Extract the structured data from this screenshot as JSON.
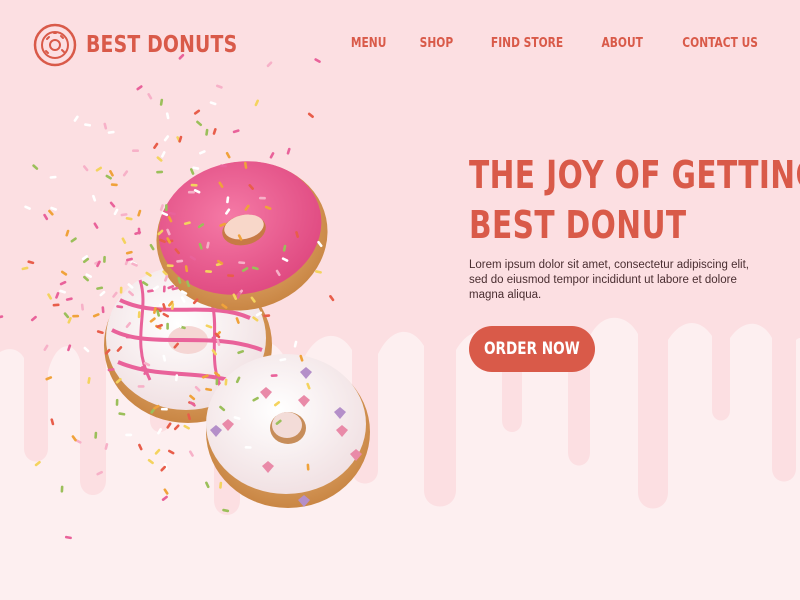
{
  "brand": {
    "name": "BEST DONUTS",
    "icon": "donut-logo-icon",
    "color": "#d95a49"
  },
  "nav": {
    "items": [
      {
        "label": "MENU"
      },
      {
        "label": "SHOP"
      },
      {
        "label": "FIND STORE"
      },
      {
        "label": "ABOUT"
      },
      {
        "label": "CONTACT US"
      }
    ]
  },
  "hero": {
    "headline_line1": "THE JOY OF GETTING",
    "headline_line2": "BEST DONUT",
    "body": "Lorem ipsum dolor sit amet, consectetur adipiscing elit, sed do eiusmod tempor incididunt ut labore et dolore magna aliqua.",
    "cta_label": "ORDER NOW"
  },
  "colors": {
    "background": "#fcdfe2",
    "drip": "#fdeff0",
    "accent": "#d95a49",
    "text": "#4a2e31"
  }
}
